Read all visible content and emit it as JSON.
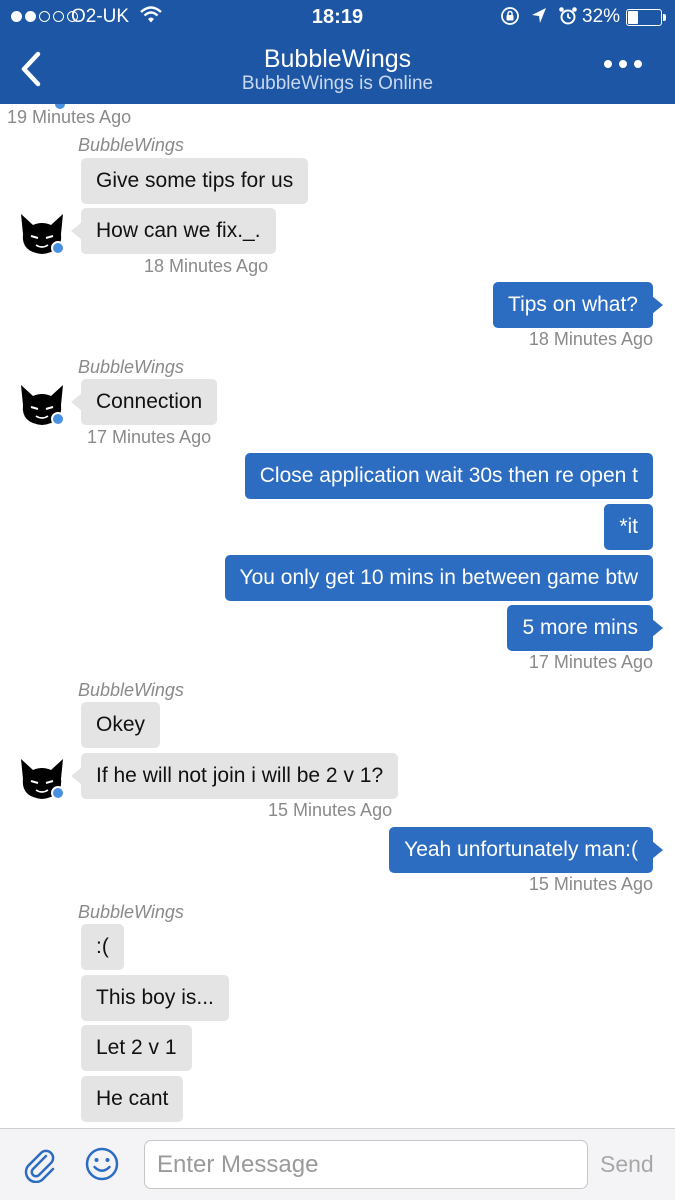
{
  "status_bar": {
    "carrier": "O2-UK",
    "time": "18:19",
    "battery": "32%",
    "battery_level": 0.32,
    "signal_bars_filled": 2,
    "signal_bars_total": 5,
    "icons": [
      "wifi-icon",
      "orientation-lock-icon",
      "location-arrow-icon",
      "alarm-clock-icon"
    ]
  },
  "nav": {
    "back_icon": "chevron-left-icon",
    "title": "BubbleWings",
    "subtitle": "BubbleWings is Online",
    "more_icon": "ellipsis-icon"
  },
  "colors": {
    "header": "#1d56a4",
    "outgoing_bubble": "#2c6dc2",
    "incoming_bubble": "#e4e4e4",
    "presence": "#4a90e2"
  },
  "chat": {
    "top_timestamp": "19 Minutes Ago",
    "groups": [
      {
        "side": "incoming",
        "sender": "BubbleWings",
        "messages": [
          "Give some tips for us",
          "How can we fix._."
        ],
        "timestamp": "18 Minutes Ago"
      },
      {
        "side": "outgoing",
        "messages": [
          "Tips on what?"
        ],
        "timestamp": "18 Minutes Ago"
      },
      {
        "side": "incoming",
        "sender": "BubbleWings",
        "messages": [
          "Connection"
        ],
        "timestamp": "17 Minutes Ago"
      },
      {
        "side": "outgoing",
        "messages": [
          "Close application wait 30s then re open t",
          "*it",
          "You only get 10 mins in between game btw",
          "5 more mins"
        ],
        "timestamp": "17 Minutes Ago"
      },
      {
        "side": "incoming",
        "sender": "BubbleWings",
        "messages": [
          "Okey",
          "If he will not join i will be 2 v 1?"
        ],
        "timestamp": "15 Minutes Ago"
      },
      {
        "side": "outgoing",
        "messages": [
          "Yeah unfortunately man:("
        ],
        "timestamp": "15 Minutes Ago"
      },
      {
        "side": "incoming",
        "sender": "BubbleWings",
        "messages": [
          ":(",
          "This boy is...",
          "Let 2 v 1",
          "He cant"
        ]
      }
    ]
  },
  "composer": {
    "attach_icon": "paperclip-icon",
    "emoji_icon": "smiley-icon",
    "placeholder": "Enter Message",
    "send_label": "Send"
  }
}
